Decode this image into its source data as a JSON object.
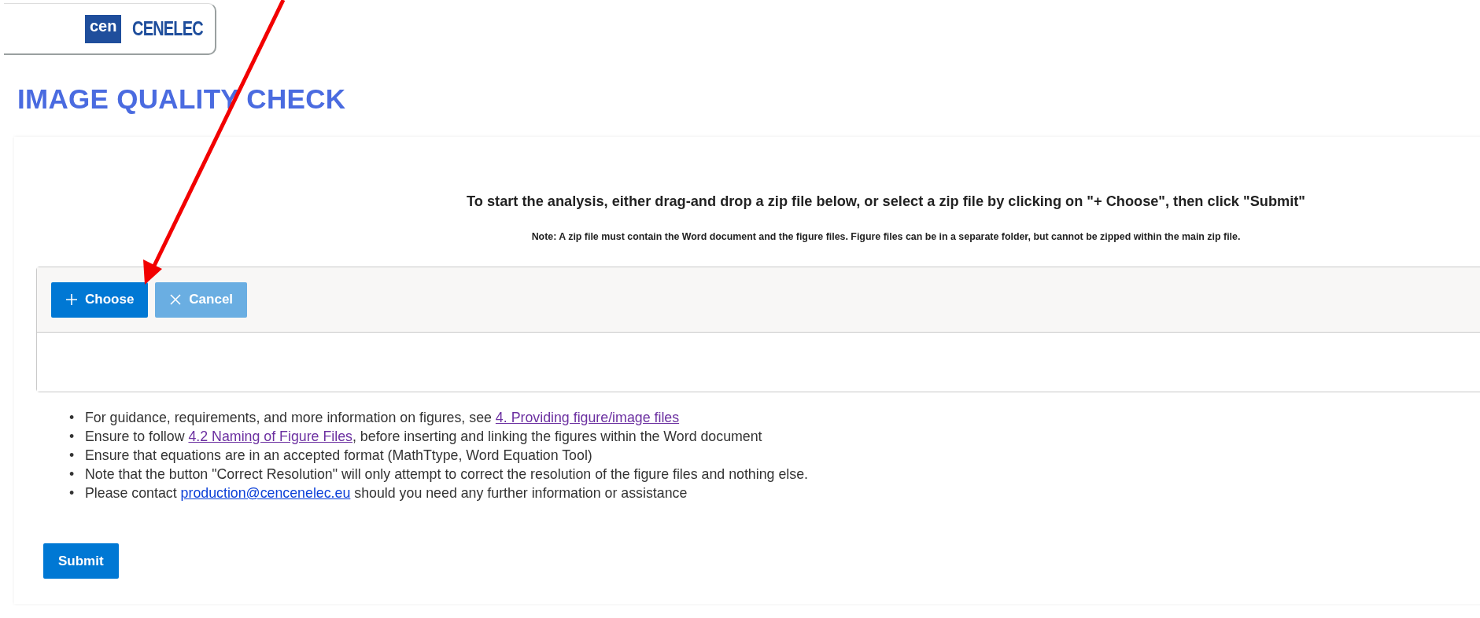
{
  "logo": {
    "mark": "cen",
    "name": "CENELEC"
  },
  "title": "IMAGE QUALITY CHECK",
  "instruction": "To start the analysis, either drag-and drop a zip file below, or select a zip file by clicking on \"+ Choose\", then click \"Submit\"",
  "note": "Note: A zip file must contain the Word document and the figure files. Figure files can be in a separate folder, but cannot be zipped within the main zip file.",
  "upload": {
    "buttons": [
      {
        "label": "Choose",
        "kind": "choose",
        "disabled": false
      },
      {
        "label": "Cancel",
        "kind": "cancel",
        "disabled": true
      }
    ]
  },
  "bullet_marker": "•",
  "bullets": [
    [
      {
        "kind": "text",
        "text": "For guidance, requirements, and more information on figures, see "
      },
      {
        "kind": "link",
        "text": "4. Providing figure/image files",
        "visited": true
      }
    ],
    [
      {
        "kind": "text",
        "text": "Ensure to follow "
      },
      {
        "kind": "link",
        "text": "4.2 Naming of Figure Files",
        "visited": true
      },
      {
        "kind": "text",
        "text": ", before inserting and linking the figures within the Word document"
      }
    ],
    [
      {
        "kind": "text",
        "text": "Ensure that equations are in an accepted format (MathTtype, Word Equation Tool)"
      }
    ],
    [
      {
        "kind": "text",
        "text": "Note that the button \"Correct Resolution\" will only attempt to correct the resolution of the figure files and nothing else."
      }
    ],
    [
      {
        "kind": "text",
        "text": "Please contact "
      },
      {
        "kind": "link",
        "text": "production@cencenelec.eu",
        "visited": false
      },
      {
        "kind": "text",
        "text": " should you need any further information or assistance"
      }
    ]
  ],
  "submit": {
    "label": "Submit"
  }
}
